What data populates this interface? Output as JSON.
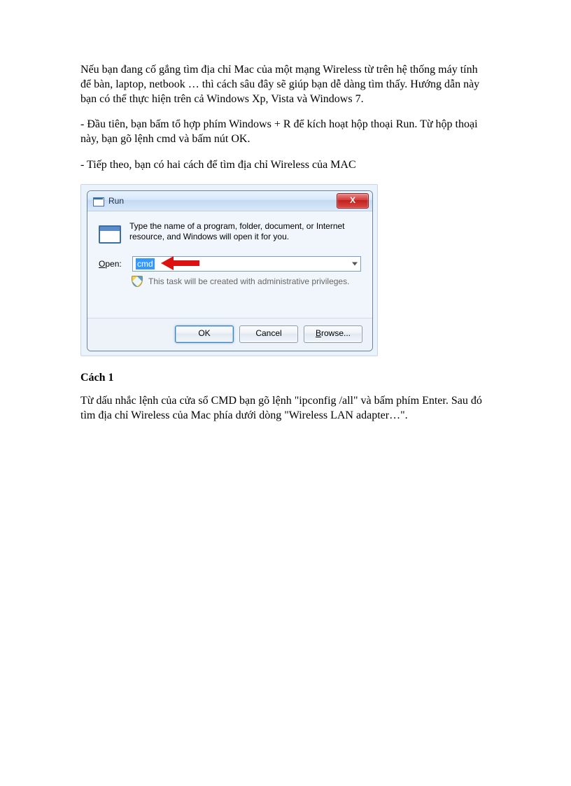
{
  "doc": {
    "p1": "Nếu bạn đang cố gắng tìm địa chỉ Mac của một mạng Wireless từ trên hệ thống máy tính để bàn, laptop, netbook … thì cách sâu đây sẽ giúp bạn dễ dàng tìm thấy. Hướng dẫn này bạn có thể thực hiện trên cả Windows Xp, Vista và Windows 7.",
    "p2": "- Đầu tiên, bạn bấm tổ hợp phím Windows + R để kích hoạt hộp thoại Run. Từ hộp thoại này, bạn gõ lệnh cmd và bấm nút OK.",
    "p3": "- Tiếp theo, bạn có hai cách để tìm địa chỉ Wireless của MAC",
    "h1": "Cách 1",
    "p4": "Từ dấu nhắc lệnh của cửa sổ CMD bạn gõ lệnh \"ipconfig /all\" và bấm phím Enter. Sau đó tìm địa chỉ Wireless của Mac phía dưới dòng \"Wireless LAN adapter…\"."
  },
  "run": {
    "title": "Run",
    "close": "X",
    "desc": "Type the name of a program, folder, document, or Internet resource, and Windows will open it for you.",
    "open_label": "Open:",
    "open_value": "cmd",
    "admin_text": "This task will be created with administrative privileges.",
    "ok": "OK",
    "cancel": "Cancel",
    "browse": "Browse..."
  }
}
